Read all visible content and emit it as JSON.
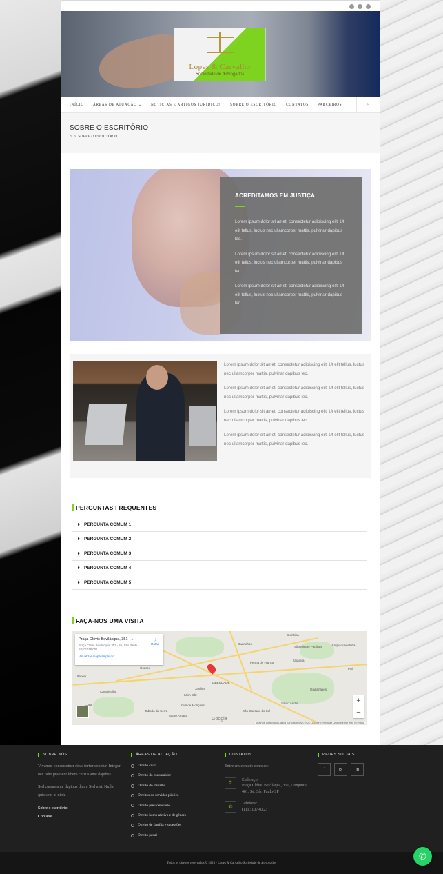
{
  "header": {
    "social_icons": [
      "facebook-icon",
      "instagram-icon",
      "linkedin-icon"
    ],
    "logo": {
      "name": "Lopes & Carvalho",
      "subtitle": "Sociedade de Advogados"
    },
    "nav": [
      "INÍCIO",
      "ÁREAS DE ATUAÇÃO",
      "NOTÍCIAS E ARTIGOS JURÍDICOS",
      "SOBRE O ESCRITÓRIO",
      "CONTATOS",
      "PARCEIROS"
    ],
    "nav_dropdown_indicator": "⌄"
  },
  "page_header": {
    "title": "SOBRE O ESCRITÓRIO",
    "breadcrumb": "SOBRE O ESCRITÓRIO",
    "breadcrumb_sep": ">"
  },
  "banner": {
    "heading": "ACREDITAMOS EM JUSTIÇA",
    "paragraphs": [
      "Lorem ipsum dolor sit amet, consectetur adipiscing elit. Ut elit tellus, luctus nec ullamcorper mattis, pulvinar dapibus leo.",
      "Lorem ipsum dolor sit amet, consectetur adipiscing elit. Ut elit tellus, luctus nec ullamcorper mattis, pulvinar dapibus leo.",
      "Lorem ipsum dolor sit amet, consectetur adipiscing elit. Ut elit tellus, luctus nec ullamcorper mattis, pulvinar dapibus leo."
    ]
  },
  "about": {
    "paragraphs": [
      "Lorem ipsum dolor sit amet, consectetur adipiscing elit. Ut elit tellus, luctus nec ullamcorper mattis, pulvinar dapibus leo.",
      "Lorem ipsum dolor sit amet, consectetur adipiscing elit. Ut elit tellus, luctus nec ullamcorper mattis, pulvinar dapibus leo.",
      "Lorem ipsum dolor sit amet, consectetur adipiscing elit. Ut elit tellus, luctus nec ullamcorper mattis, pulvinar dapibus leo.",
      "Lorem ipsum dolor sit amet, consectetur adipiscing elit. Ut elit tellus, luctus nec ullamcorper mattis, pulvinar dapibus leo."
    ]
  },
  "faq": {
    "title": "PERGUNTAS FREQUENTES",
    "items": [
      "PERGUNTA COMUM 1",
      "PERGUNTA COMUM 2",
      "PERGUNTA COMUM 3",
      "PERGUNTA COMUM 4",
      "PERGUNTA COMUM 5"
    ]
  },
  "visit": {
    "title": "FAÇA-NOS UMA VISITA",
    "map": {
      "place": "Praça Clóvis Bevilácqua, 351 - ...",
      "address": "Praça Clóvis Bevilácqua, 351 - Sé, São Paulo - SP, 01018-001",
      "link": "Visualizar mapa ampliado",
      "routes": "Rotas",
      "labels": [
        "Itapevi",
        "Osasco",
        "Carapicuíba",
        "Cotia",
        "Taboão da Serra",
        "LIBERDADE",
        "Guarulhos",
        "Penha de França",
        "São Miguel Paulista",
        "Itaquera",
        "Santo André",
        "São Caetano do Sul",
        "Cumbica",
        "Itaquaquecetuba",
        "Poá",
        "Guaianases",
        "Jardins",
        "Itaim Bibi",
        "Cidade Monções",
        "Santo Amaro"
      ],
      "footer": "Atalhos do teclado   Dados cartográficos ©2020 Google   Termos de Uso   Informar erro no mapa",
      "google": "Google"
    }
  },
  "footer": {
    "sobre": {
      "title": "SOBRE NÓS",
      "p1": "Vivamus consectetuer risus tortor conctur. Integer nec odio praesent libero cursus ante dapibus.",
      "p2": "Sed cursus ante dapibus diam. Sed nisi. Nulla quis sem at nibh.",
      "links": [
        "Sobre o escritório",
        "Contatos"
      ]
    },
    "areas": {
      "title": "ÁREAS DE ATUAÇÃO",
      "items": [
        "Direito civil",
        "Direito do consumidor",
        "Direito do trabalho",
        "Direitos do servidor público",
        "Direito previdenciário",
        "Direito homo afetivo e de gênero",
        "Direito de família e sucessões",
        "Direito penal"
      ]
    },
    "contatos": {
      "title": "CONTATOS",
      "intro": "Entre em contato conosco:",
      "endereco_label": "Endereço:",
      "endereco": "Praça Clóvis Beviláqua, 351, Conjunto 401, Sé, São Paulo-SP",
      "telefone_label": "Telefone:",
      "telefone": "(11) 3107-0323"
    },
    "redes": {
      "title": "REDES SOCIAIS",
      "icons": [
        "f",
        "◎",
        "in"
      ]
    },
    "copyright": "Todos os direitos reservados © 2020 - Lopes & Carvalho Sociedade de Advogados"
  },
  "colors": {
    "accent": "#7ed321",
    "dark": "#202020",
    "whatsapp": "#25d366"
  }
}
